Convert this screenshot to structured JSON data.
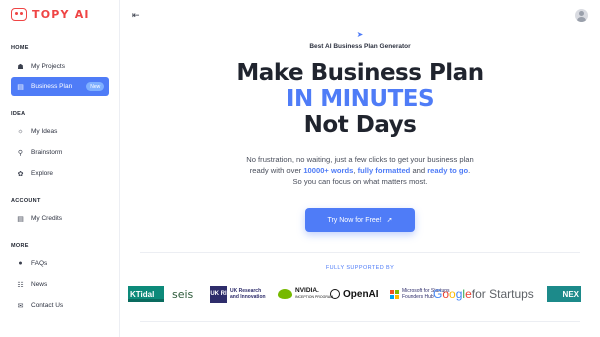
{
  "app": {
    "logo_text": "TOPY AI"
  },
  "sidebar": {
    "sections": {
      "home": "HOME",
      "idea": "IDEA",
      "account": "ACCOUNT",
      "more": "MORE"
    },
    "items": [
      {
        "label": "My Projects",
        "icon": "folder-icon"
      },
      {
        "label": "Business Plan",
        "icon": "document-icon",
        "badge": "New",
        "active": true
      },
      {
        "label": "My Ideas",
        "icon": "lightbulb-icon"
      },
      {
        "label": "Brainstorm",
        "icon": "search-icon"
      },
      {
        "label": "Explore",
        "icon": "explore-icon"
      },
      {
        "label": "My Credits",
        "icon": "credits-icon"
      },
      {
        "label": "FAQs",
        "icon": "faq-icon"
      },
      {
        "label": "News",
        "icon": "news-icon"
      },
      {
        "label": "Contact Us",
        "icon": "contact-icon"
      }
    ]
  },
  "hero": {
    "eyebrow": "Best AI Business Plan Generator",
    "line1": "Make Business Plan",
    "line2": "IN MINUTES",
    "line3": "Not Days",
    "desc_1": "No frustration, no waiting, just a few clicks to get your business plan",
    "desc_2a": "ready with over ",
    "desc_2b": "10000+ words",
    "desc_2c": ", ",
    "desc_2d": "fully formatted",
    "desc_2e": " and ",
    "desc_2f": "ready to go",
    "desc_2g": ".",
    "desc_3": "So you can focus on what matters most.",
    "cta": "Try Now for Free!"
  },
  "partners": {
    "title": "FULLY SUPPORTED BY",
    "tidal": "KTidal",
    "seis": "seis",
    "ukri_mark": "UK RI",
    "ukri_line1": "UK Research",
    "ukri_line2": "and Innovation",
    "nvidia": "NVIDIA.",
    "nvidia_sub": "INCEPTION PROGRAM",
    "openai": "OpenAI",
    "ms_line1": "Microsoft for Startups",
    "ms_line2": "Founders Hub",
    "google_G": "G",
    "google_o1": "o",
    "google_o2": "o",
    "google_g": "g",
    "google_l": "l",
    "google_e": "e",
    "google_rest": " for Startups",
    "nex": "NEX"
  },
  "colors": {
    "accent": "#4f7cf7",
    "brand": "#ef4444"
  }
}
